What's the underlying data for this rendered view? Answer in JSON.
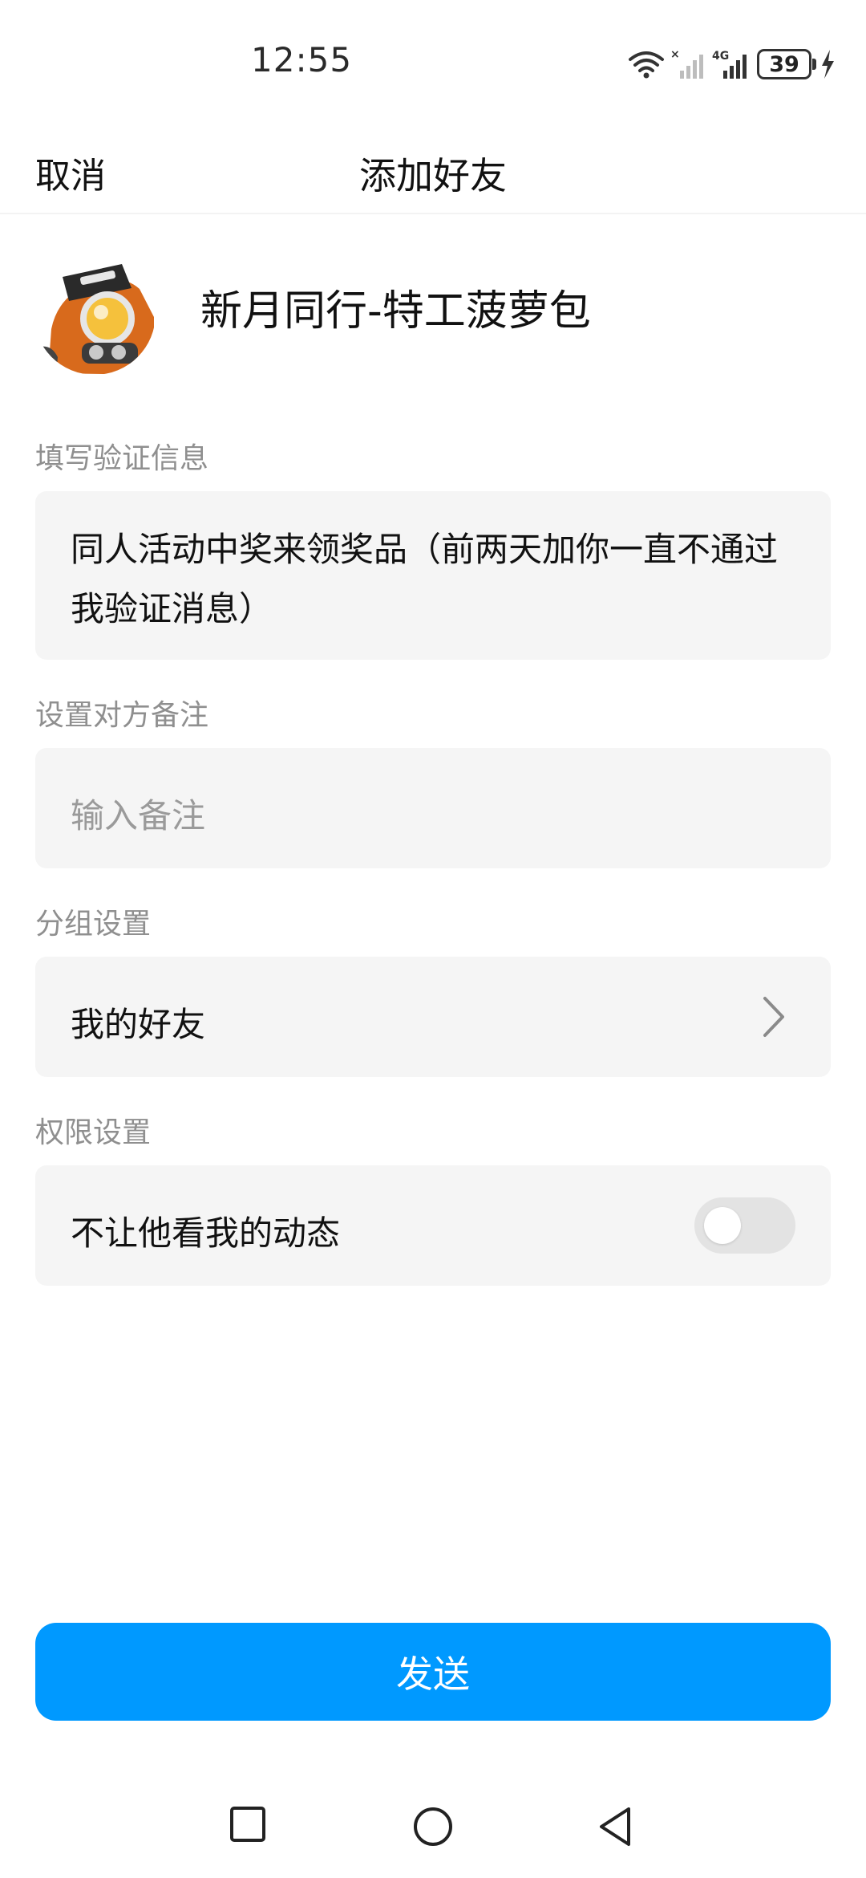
{
  "status_bar": {
    "time": "12:55",
    "battery": "39",
    "network": "4G",
    "icons": [
      "wifi-icon",
      "signal-no-service-icon",
      "signal-4g-icon",
      "battery-icon",
      "charging-icon"
    ]
  },
  "nav": {
    "cancel_label": "取消",
    "title": "添加好友"
  },
  "profile": {
    "name": "新月同行-特工菠萝包",
    "avatar_icon": "avatar-robot"
  },
  "verification": {
    "label": "填写验证信息",
    "message": "同人活动中奖来领奖品（前两天加你一直不通过我验证消息）"
  },
  "remark": {
    "label": "设置对方备注",
    "placeholder": "输入备注",
    "value": ""
  },
  "group": {
    "label": "分组设置",
    "value": "我的好友",
    "icon": "chevron-right-icon"
  },
  "permission": {
    "label": "权限设置",
    "option_label": "不让他看我的动态",
    "enabled": false
  },
  "send_button_label": "发送",
  "colors": {
    "accent": "#0099ff",
    "card_bg": "#f5f5f5",
    "label_text": "#8f8f8f",
    "placeholder_text": "#9a9a9a"
  },
  "system_nav": [
    "recent-apps-icon",
    "home-icon",
    "back-icon"
  ]
}
